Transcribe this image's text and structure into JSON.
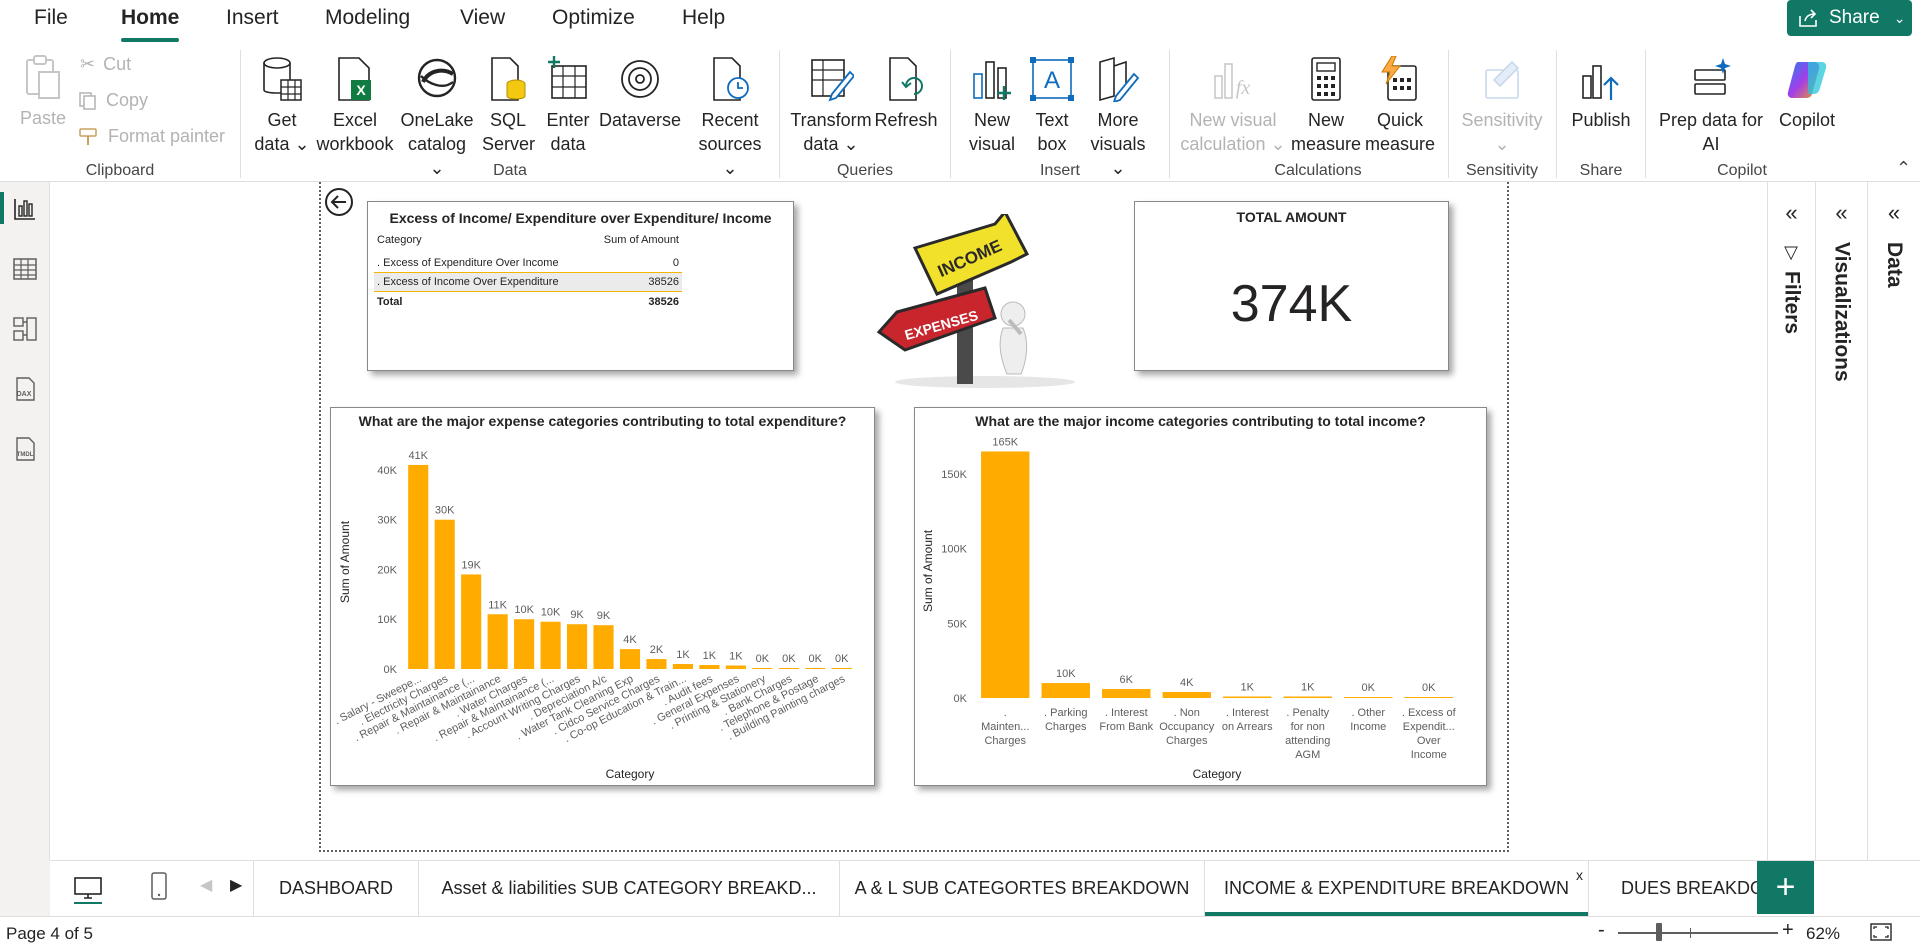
{
  "menu": {
    "tabs": [
      {
        "label": "File"
      },
      {
        "label": "Home"
      },
      {
        "label": "Insert"
      },
      {
        "label": "Modeling"
      },
      {
        "label": "View"
      },
      {
        "label": "Optimize"
      },
      {
        "label": "Help"
      }
    ],
    "active_tab": "Home",
    "share_label": "Share"
  },
  "ribbon": {
    "clipboard": {
      "paste": "Paste",
      "cut": "Cut",
      "copy": "Copy",
      "format_painter": "Format painter",
      "group": "Clipboard"
    },
    "data": {
      "get_data": [
        "Get",
        "data"
      ],
      "excel": [
        "Excel",
        "workbook"
      ],
      "onelake": [
        "OneLake",
        "catalog"
      ],
      "sql": [
        "SQL",
        "Server"
      ],
      "enter_data": [
        "Enter",
        "data"
      ],
      "dataverse": "Dataverse",
      "recent": [
        "Recent",
        "sources"
      ],
      "group": "Data"
    },
    "queries": {
      "transform": [
        "Transform",
        "data"
      ],
      "refresh": "Refresh",
      "group": "Queries"
    },
    "insert": {
      "new_visual": [
        "New",
        "visual"
      ],
      "text_box": [
        "Text",
        "box"
      ],
      "more_visuals": [
        "More",
        "visuals"
      ],
      "group": "Insert"
    },
    "calculations": {
      "new_visual_calc": [
        "New visual",
        "calculation"
      ],
      "new_measure": [
        "New",
        "measure"
      ],
      "quick_measure": [
        "Quick",
        "measure"
      ],
      "group": "Calculations"
    },
    "sensitivity": {
      "label": "Sensitivity",
      "group": "Sensitivity"
    },
    "share": {
      "publish": "Publish",
      "group": "Share"
    },
    "copilot": {
      "prep": [
        "Prep data for",
        "AI"
      ],
      "copilot": "Copilot",
      "group": "Copilot"
    }
  },
  "matrix": {
    "title": "Excess of Income/ Expenditure over Expenditure/ Income",
    "headers": [
      "Category",
      "Sum of Amount"
    ],
    "rows": [
      {
        "category": ". Excess of Expenditure Over Income",
        "value": "0"
      },
      {
        "category": ". Excess of Income Over Expenditure",
        "value": "38526"
      }
    ],
    "total": {
      "label": "Total",
      "value": "38526"
    }
  },
  "image_card": {
    "top_sign": "INCOME",
    "bottom_sign": "EXPENSES"
  },
  "kpi": {
    "title": "TOTAL AMOUNT",
    "value": "374K"
  },
  "expense_chart": {
    "title": "What are the major expense categories contributing to total expenditure?",
    "chart_data": {
      "type": "bar",
      "title": "What are the major expense categories contributing to total expenditure?",
      "xlabel": "Category",
      "ylabel": "Sum of Amount",
      "ylim": [
        0,
        43000
      ],
      "yticks": [
        0,
        10000,
        20000,
        30000,
        40000
      ],
      "ytick_labels": [
        "0K",
        "10K",
        "20K",
        "30K",
        "40K"
      ],
      "categories": [
        ". Salary - Sweepe...",
        ". Electricity Charges",
        ". Repair & Maintainance (...",
        ". Repair & Maintainance",
        ". Water Charges",
        ". Repair & Maintainance (...",
        ". Account Writing Charges",
        ". Depreciation A/c",
        ". Water Tank Cleaning Exp",
        ". Cidco Service Charges",
        ". Co-op Education & Train...",
        ". Audit fees",
        ". General Expenses",
        ". Printing & Stationery",
        ". Bank Charges",
        ". Telephone & Postage",
        ". Building Painting charges"
      ],
      "values": [
        41000,
        30000,
        19000,
        11000,
        10000,
        9500,
        9000,
        8800,
        4000,
        2000,
        1000,
        800,
        700,
        200,
        150,
        100,
        50
      ],
      "data_labels": [
        "41K",
        "30K",
        "19K",
        "11K",
        "10K",
        "10K",
        "9K",
        "9K",
        "4K",
        "2K",
        "1K",
        "1K",
        "1K",
        "0K",
        "0K",
        "0K",
        "0K"
      ],
      "color": "#FFAB00"
    }
  },
  "income_chart": {
    "title": "What are the major income categories contributing to total income?",
    "chart_data": {
      "type": "bar",
      "title": "What are the major income categories contributing to total income?",
      "xlabel": "Category",
      "ylabel": "Sum of Amount",
      "ylim": [
        0,
        170000
      ],
      "yticks": [
        0,
        50000,
        100000,
        150000
      ],
      "ytick_labels": [
        "0K",
        "50K",
        "100K",
        "150K"
      ],
      "categories": [
        [
          ".",
          "Mainten...",
          "Charges"
        ],
        [
          ". Parking",
          "Charges"
        ],
        [
          ". Interest",
          "From Bank"
        ],
        [
          ". Non",
          "Occupancy",
          "Charges"
        ],
        [
          ". Interest",
          "on Arrears"
        ],
        [
          ". Penalty",
          "for non",
          "attending",
          "AGM"
        ],
        [
          ". Other",
          "Income"
        ],
        [
          ". Excess of",
          "Expendit...",
          "Over",
          "Income"
        ]
      ],
      "values": [
        165000,
        10000,
        6000,
        4000,
        1000,
        1000,
        200,
        0
      ],
      "data_labels": [
        "165K",
        "10K",
        "6K",
        "4K",
        "1K",
        "1K",
        "0K",
        "0K"
      ],
      "color": "#FFAB00"
    }
  },
  "panes": {
    "filters": "Filters",
    "visualizations": "Visualizations",
    "data": "Data"
  },
  "page_tabs": [
    "DASHBOARD",
    "Asset & liabilities SUB CATEGORY BREAKD...",
    "A & L SUB CATEGORTES BREAKDOWN",
    "INCOME & EXPENDITURE BREAKDOWN",
    "DUES BREAKDOWN"
  ],
  "active_page_tab": "INCOME & EXPENDITURE BREAKDOWN",
  "tab_close": "x",
  "add_page": "+",
  "status": {
    "page": "Page 4 of 5",
    "zoom": "62%",
    "zoom_minus": "-",
    "zoom_plus": "+"
  },
  "colors": {
    "accent": "#117865",
    "bar": "#FFAB00"
  }
}
